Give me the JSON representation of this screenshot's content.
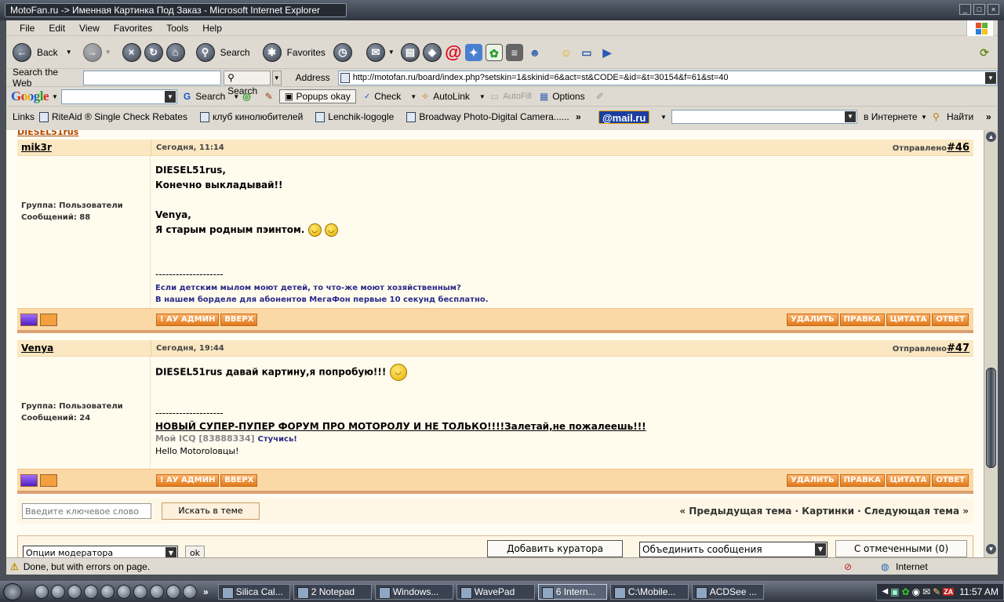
{
  "window": {
    "title": "MotoFan.ru -> Именная Картинка Под Заказ - Microsoft Internet Explorer"
  },
  "menu": [
    "File",
    "Edit",
    "View",
    "Favorites",
    "Tools",
    "Help"
  ],
  "toolbar": {
    "back": "Back",
    "search": "Search",
    "favorites": "Favorites"
  },
  "addressbar": {
    "search_web_label": "Search the Web",
    "search_button": "Search",
    "address_label": "Address",
    "url": "http://motofan.ru/board/index.php?setskin=1&skinid=6&act=st&CODE=&id=&t=30154&f=61&st=40"
  },
  "google_toolbar": {
    "google": "Google",
    "search": "Search",
    "popups": "Popups okay",
    "check": "Check",
    "autolink": "AutoLink",
    "autofill": "AutoFill",
    "options": "Options"
  },
  "links_bar": {
    "label": "Links",
    "items": [
      "RiteAid ® Single Check Rebates",
      "клуб кинолюбителей",
      "Lenchik-logogle",
      "Broadway Photo-Digital Camera......"
    ],
    "mail": "@mail.ru",
    "internet": "в Интернете",
    "find": "Найти"
  },
  "prev_author": "DIESEL51rus",
  "posts": [
    {
      "author": "mik3r",
      "date": "Сегодня, 11:14",
      "sent_label": "Отправлено",
      "number": "#46",
      "group": "Группа: Пользователи",
      "count": "Сообщений: 88",
      "lines": [
        "DIESEL51rus,",
        "Конечно выкладывай!!",
        "",
        "Venya,",
        "Я старым родным пэинтом."
      ],
      "sig_rule": "--------------------",
      "sig1": "Если детским мылом моют детей, то что-же моют хозяйственным?",
      "sig2": "В нашем борделе для абонентов МегаФон первые 10 секунд бесплатно."
    },
    {
      "author": "Venya",
      "date": "Сегодня, 19:44",
      "sent_label": "Отправлено",
      "number": "#47",
      "group": "Группа: Пользователи",
      "count": "Сообщений: 24",
      "lines": [
        "DIESEL51rus давай картину,я попробую!!!"
      ],
      "sig_rule": "--------------------",
      "sig_link": "НОВЫЙ СУПЕР-ПУПЕР ФОРУМ ПРО МОТОРОЛУ И НЕ ТОЛЬКО!!!!Залетай,не пожалеешь!!!",
      "icq_label": "Мой ICQ [83888334]",
      "icq_action": "Стучись!",
      "hello": "Hello Motorolовцы!"
    }
  ],
  "post_buttons": {
    "admin": "! АУ АДМИН",
    "up": "ВВЕРХ",
    "delete": "УДАЛИТЬ",
    "edit": "ПРАВКА",
    "quote": "ЦИТАТА",
    "reply": "ОТВЕТ"
  },
  "bottom": {
    "search_placeholder": "Введите ключевое слово",
    "search_button": "Искать в теме",
    "nav": "« Предыдущая тема · Картинки · Следующая тема »",
    "mod_options": "Опции модератора",
    "ok": "ok",
    "add_curator": "Добавить куратора",
    "merge": "Объединить сообщения",
    "selected": "С отмеченными (0)"
  },
  "status": {
    "text": "Done, but with errors on page.",
    "zone": "Internet"
  },
  "taskbar": {
    "tasks": [
      "Silica Cal...",
      "2 Notepad",
      "Windows...",
      "WavePad",
      "6 Intern...",
      "C:\\Mobile...",
      "ACDSee ..."
    ],
    "clock": "11:57 AM"
  }
}
